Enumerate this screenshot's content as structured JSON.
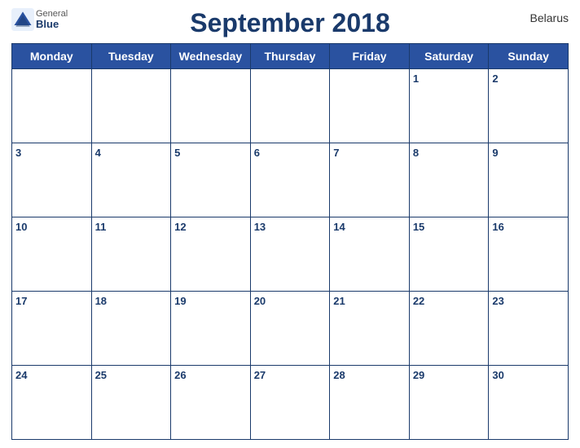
{
  "header": {
    "title": "September 2018",
    "country": "Belarus",
    "logo": {
      "general": "General",
      "blue": "Blue"
    }
  },
  "days": [
    "Monday",
    "Tuesday",
    "Wednesday",
    "Thursday",
    "Friday",
    "Saturday",
    "Sunday"
  ],
  "weeks": [
    [
      null,
      null,
      null,
      null,
      null,
      "1",
      "2"
    ],
    [
      "3",
      "4",
      "5",
      "6",
      "7",
      "8",
      "9"
    ],
    [
      "10",
      "11",
      "12",
      "13",
      "14",
      "15",
      "16"
    ],
    [
      "17",
      "18",
      "19",
      "20",
      "21",
      "22",
      "23"
    ],
    [
      "24",
      "25",
      "26",
      "27",
      "28",
      "29",
      "30"
    ]
  ]
}
